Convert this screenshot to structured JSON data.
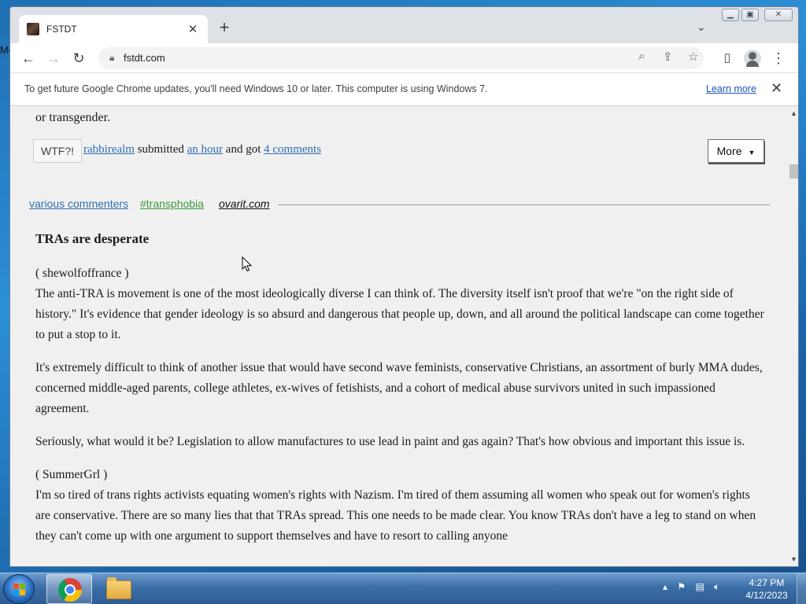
{
  "browser": {
    "tab_title": "FSTDT",
    "url": "fstdt.com",
    "infobar_message": "To get future Google Chrome updates, you'll need Windows 10 or later. This computer is using Windows 7.",
    "infobar_link": "Learn more"
  },
  "previous_post": {
    "tail_text": "or transgender.",
    "rating_label": "WTF?!",
    "author": "rabbirealm",
    "submitted_word": "submitted",
    "time": "an hour",
    "got_text": "and got",
    "comments": "4 comments",
    "more_button": "More"
  },
  "post": {
    "author": "various commenters",
    "tag": "#transphobia",
    "source": "ovarit.com",
    "title": "TRAs are desperate",
    "paragraphs": {
      "p1_who": "( shewolfoffrance )",
      "p1": "The anti-TRA is movement is one of the most ideologically diverse I can think of. The diversity itself isn't proof that we're \"on the right side of history.\" It's evidence that gender ideology is so absurd and dangerous that people up, down, and all around the political landscape can come together to put a stop to it.",
      "p2": "It's extremely difficult to think of another issue that would have second wave feminists, conservative Christians, an assortment of burly MMA dudes, concerned middle-aged parents, college athletes, ex-wives of fetishists, and a cohort of medical abuse survivors united in such impassioned agreement.",
      "p3": "Seriously, what would it be? Legislation to allow manufactures to use lead in paint and gas again? That's how obvious and important this issue is.",
      "p4_who": "( SummerGrl )",
      "p4": "I'm so tired of trans rights activists equating women's rights with Nazism. I'm tired of them assuming all women who speak out for women's rights are conservative. There are so many lies that that TRAs spread. This one needs to be made clear. You know TRAs don't have a leg to stand on when they can't come up with one argument to support themselves and have to resort to calling anyone"
    }
  },
  "taskbar": {
    "time": "4:27 PM",
    "date": "4/12/2023"
  },
  "colors": {
    "link": "#2f6fb3",
    "tag": "#3c9a3c",
    "page_bg": "#f0f0f0"
  }
}
